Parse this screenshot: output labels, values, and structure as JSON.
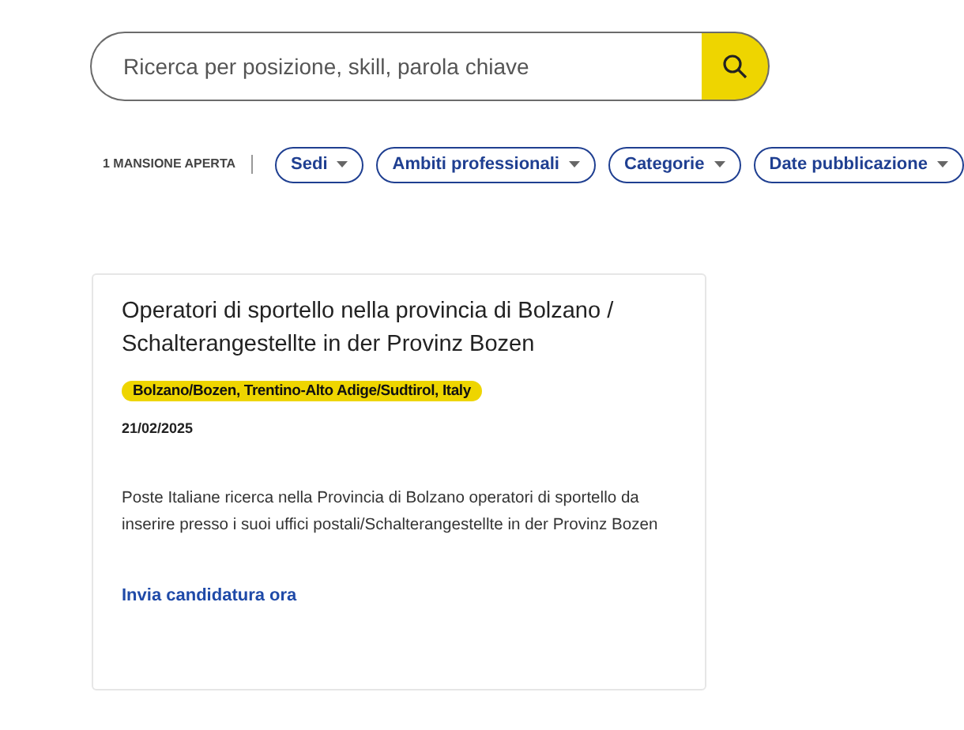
{
  "search": {
    "placeholder": "Ricerca per posizione, skill, parola chiave"
  },
  "results_count": "1 MANSIONE APERTA",
  "filters": [
    {
      "label": "Sedi"
    },
    {
      "label": "Ambiti professionali"
    },
    {
      "label": "Categorie"
    },
    {
      "label": "Date pubblicazione"
    }
  ],
  "jobs": [
    {
      "title": "Operatori di sportello nella provincia di Bolzano / Schalterangestellte in der Provinz Bozen",
      "location": "Bolzano/Bozen, Trentino-Alto Adige/Sudtirol, Italy",
      "date": "21/02/2025",
      "description": "Poste Italiane ricerca nella Provincia di Bolzano operatori di sportello da inserire presso i suoi uffici postali/Schalterangestellte in der Provinz Bozen",
      "apply": "Invia candidatura ora"
    }
  ]
}
